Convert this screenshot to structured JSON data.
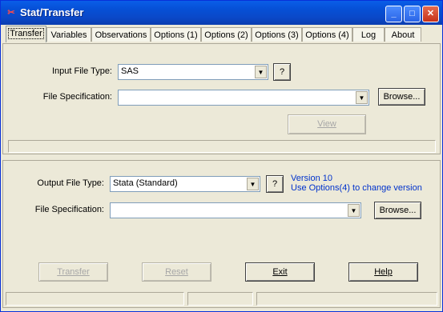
{
  "window": {
    "title": "Stat/Transfer",
    "controls": {
      "minimize": "_",
      "maximize": "□",
      "close": "✕"
    }
  },
  "tabs": [
    {
      "label": "Transfer",
      "active": true
    },
    {
      "label": "Variables"
    },
    {
      "label": "Observations"
    },
    {
      "label": "Options (1)"
    },
    {
      "label": "Options (2)"
    },
    {
      "label": "Options (3)"
    },
    {
      "label": "Options (4)"
    },
    {
      "label": "Log"
    },
    {
      "label": "About"
    }
  ],
  "input": {
    "type_label": "Input File Type:",
    "type_value": "SAS",
    "help_label": "?",
    "spec_label": "File Specification:",
    "spec_value": "",
    "browse_label": "Browse...",
    "view_label": "View"
  },
  "output": {
    "type_label": "Output File Type:",
    "type_value": "Stata (Standard)",
    "help_label": "?",
    "version_line1": "Version 10",
    "version_line2": "Use Options(4) to change version",
    "spec_label": "File Specification:",
    "spec_value": "",
    "browse_label": "Browse..."
  },
  "actions": {
    "transfer": "Transfer",
    "reset": "Reset",
    "exit": "Exit",
    "help": "Help"
  },
  "icons": {
    "app": "stat-transfer-app-icon",
    "dropdown": "chevron-down-icon"
  },
  "colors": {
    "title_bar": "#0a5ee8",
    "accent_text": "#0032cc",
    "face": "#ece9d8"
  }
}
